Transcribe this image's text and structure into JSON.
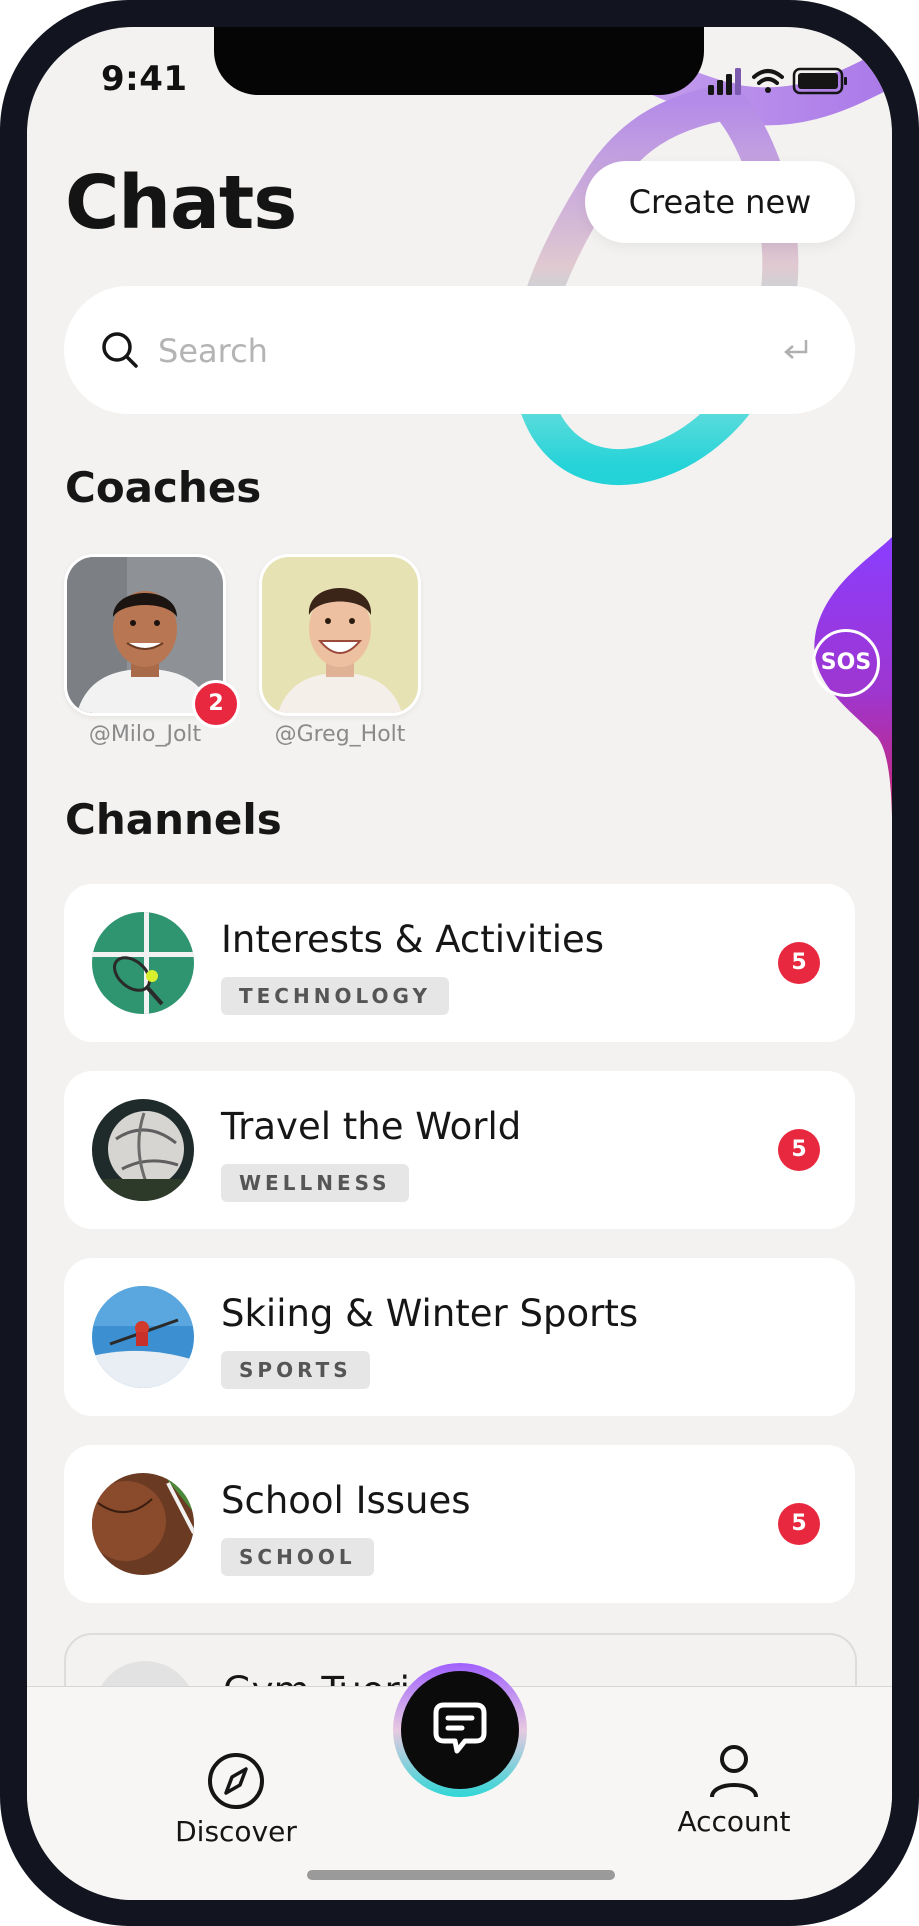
{
  "status_bar": {
    "time": "9:41"
  },
  "header": {
    "title": "Chats",
    "create_button": "Create new"
  },
  "search": {
    "placeholder": "Search"
  },
  "coaches": {
    "title": "Coaches",
    "items": [
      {
        "handle": "@Milo_Jolt",
        "badge": "2"
      },
      {
        "handle": "@Greg_Holt",
        "badge": ""
      }
    ]
  },
  "sos": {
    "label": "SOS"
  },
  "channels": {
    "title": "Channels",
    "items": [
      {
        "name": "Interests & Activities",
        "tag": "TECHNOLOGY",
        "unread": "5"
      },
      {
        "name": "Travel the World",
        "tag": "WELLNESS",
        "unread": "5"
      },
      {
        "name": "Skiing & Winter Sports",
        "tag": "SPORTS",
        "unread": ""
      },
      {
        "name": "School Issues",
        "tag": "SCHOOL",
        "unread": "5"
      },
      {
        "name": "Gym Tuori",
        "tag": "",
        "unread": ""
      }
    ]
  },
  "tab_bar": {
    "discover": "Discover",
    "account": "Account"
  },
  "colors": {
    "accent_purple": "#9b4dff",
    "accent_teal": "#2fd8d8",
    "badge_red": "#e8283f",
    "sos_magenta": "#c2287a"
  }
}
